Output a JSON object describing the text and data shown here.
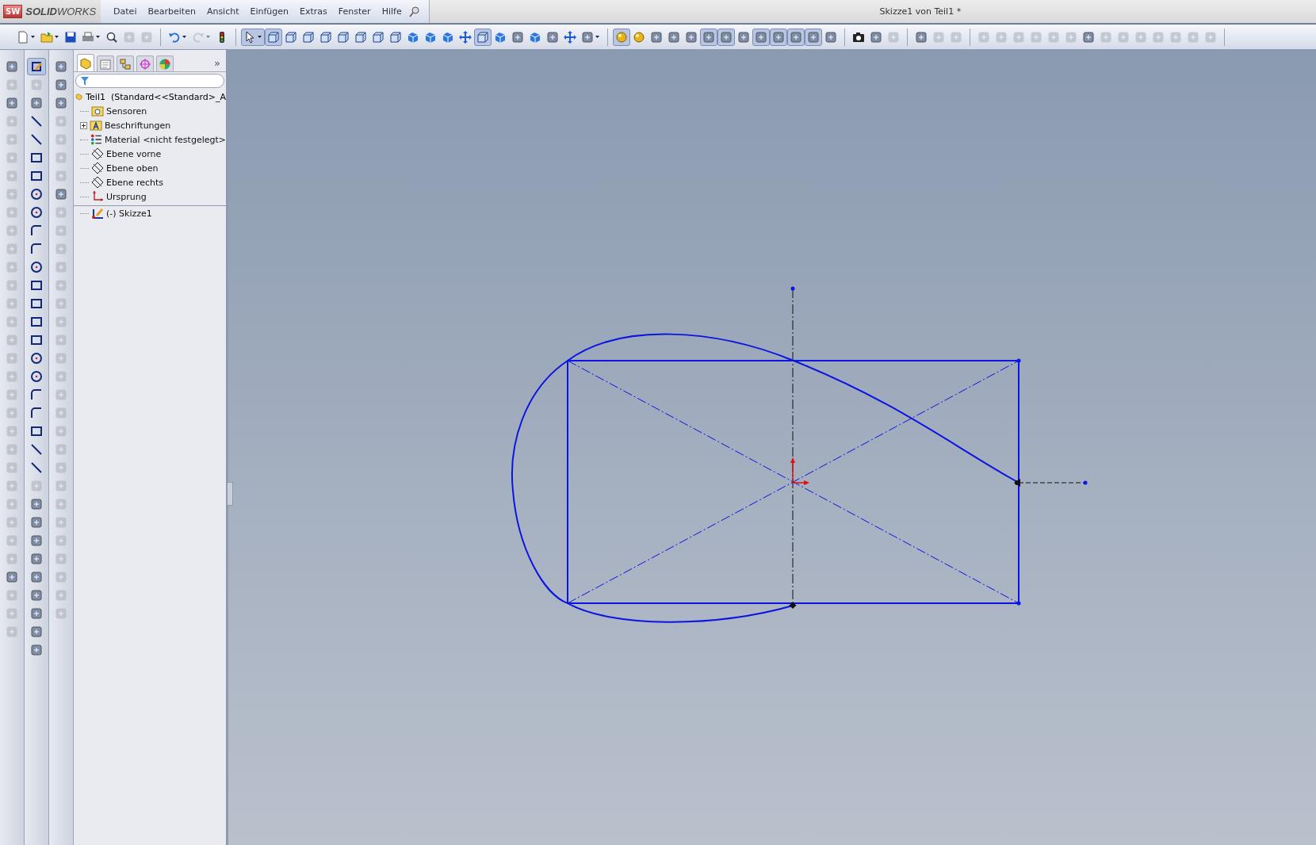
{
  "app": {
    "logo_badge": "SW",
    "logo_bold": "SOLID",
    "logo_rest": "WORKS"
  },
  "menu": [
    "Datei",
    "Bearbeiten",
    "Ansicht",
    "Einfügen",
    "Extras",
    "Fenster",
    "Hilfe"
  ],
  "window": {
    "title": "Skizze1 von Teil1 *"
  },
  "toolbar": {
    "groups": [
      [
        {
          "pressed": false,
          "disabled": false,
          "dropdown": true
        },
        {
          "pressed": false,
          "disabled": false,
          "dropdown": true
        },
        {
          "pressed": false,
          "disabled": false,
          "dropdown": false
        },
        {
          "pressed": false,
          "disabled": false,
          "dropdown": true
        },
        {
          "pressed": false,
          "disabled": false,
          "dropdown": false
        },
        {
          "pressed": false,
          "disabled": true,
          "dropdown": false
        },
        {
          "pressed": false,
          "disabled": true,
          "dropdown": false
        }
      ],
      [
        {
          "pressed": false,
          "disabled": false,
          "dropdown": true
        },
        {
          "pressed": false,
          "disabled": true,
          "dropdown": true
        },
        {
          "pressed": false,
          "disabled": false,
          "dropdown": false
        }
      ],
      [
        {
          "pressed": true,
          "disabled": false,
          "dropdown": true
        },
        {
          "pressed": true,
          "disabled": false,
          "dropdown": false
        },
        {
          "pressed": false,
          "disabled": false,
          "dropdown": false
        },
        {
          "pressed": false,
          "disabled": false,
          "dropdown": false
        },
        {
          "pressed": false,
          "disabled": false,
          "dropdown": false
        },
        {
          "pressed": false,
          "disabled": false,
          "dropdown": false
        },
        {
          "pressed": false,
          "disabled": false,
          "dropdown": false
        },
        {
          "pressed": false,
          "disabled": false,
          "dropdown": false
        },
        {
          "pressed": false,
          "disabled": false,
          "dropdown": false
        },
        {
          "pressed": false,
          "disabled": false,
          "dropdown": false
        },
        {
          "pressed": false,
          "disabled": false,
          "dropdown": false
        },
        {
          "pressed": false,
          "disabled": false,
          "dropdown": false
        },
        {
          "pressed": false,
          "disabled": false,
          "dropdown": false
        },
        {
          "pressed": true,
          "disabled": false,
          "dropdown": false
        },
        {
          "pressed": false,
          "disabled": false,
          "dropdown": false
        },
        {
          "pressed": false,
          "disabled": false,
          "dropdown": false
        },
        {
          "pressed": false,
          "disabled": false,
          "dropdown": false
        },
        {
          "pressed": false,
          "disabled": false,
          "dropdown": false
        },
        {
          "pressed": false,
          "disabled": false,
          "dropdown": false
        },
        {
          "pressed": false,
          "disabled": false,
          "dropdown": true
        }
      ],
      [
        {
          "pressed": true,
          "disabled": false,
          "dropdown": false
        },
        {
          "pressed": false,
          "disabled": false,
          "dropdown": false
        },
        {
          "pressed": false,
          "disabled": false,
          "dropdown": false
        },
        {
          "pressed": false,
          "disabled": false,
          "dropdown": false
        },
        {
          "pressed": false,
          "disabled": false,
          "dropdown": false
        },
        {
          "pressed": true,
          "disabled": false,
          "dropdown": false
        },
        {
          "pressed": true,
          "disabled": false,
          "dropdown": false
        },
        {
          "pressed": false,
          "disabled": false,
          "dropdown": false
        },
        {
          "pressed": true,
          "disabled": false,
          "dropdown": false
        },
        {
          "pressed": true,
          "disabled": false,
          "dropdown": false
        },
        {
          "pressed": true,
          "disabled": false,
          "dropdown": false
        },
        {
          "pressed": true,
          "disabled": false,
          "dropdown": false
        },
        {
          "pressed": false,
          "disabled": false,
          "dropdown": false
        }
      ],
      [
        {
          "pressed": false,
          "disabled": false,
          "dropdown": false
        },
        {
          "pressed": false,
          "disabled": false,
          "dropdown": false
        },
        {
          "pressed": false,
          "disabled": true,
          "dropdown": false
        }
      ],
      [
        {
          "pressed": false,
          "disabled": false,
          "dropdown": false
        },
        {
          "pressed": false,
          "disabled": true,
          "dropdown": false
        },
        {
          "pressed": false,
          "disabled": true,
          "dropdown": false
        }
      ],
      [
        {
          "pressed": false,
          "disabled": true,
          "dropdown": false
        },
        {
          "pressed": false,
          "disabled": true,
          "dropdown": false
        },
        {
          "pressed": false,
          "disabled": true,
          "dropdown": false
        },
        {
          "pressed": false,
          "disabled": true,
          "dropdown": false
        },
        {
          "pressed": false,
          "disabled": true,
          "dropdown": false
        },
        {
          "pressed": false,
          "disabled": true,
          "dropdown": false
        },
        {
          "pressed": false,
          "disabled": false,
          "dropdown": false
        },
        {
          "pressed": false,
          "disabled": true,
          "dropdown": false
        },
        {
          "pressed": false,
          "disabled": true,
          "dropdown": false
        },
        {
          "pressed": false,
          "disabled": true,
          "dropdown": false
        },
        {
          "pressed": false,
          "disabled": true,
          "dropdown": false
        },
        {
          "pressed": false,
          "disabled": true,
          "dropdown": false
        },
        {
          "pressed": false,
          "disabled": true,
          "dropdown": false
        },
        {
          "pressed": false,
          "disabled": true,
          "dropdown": false
        }
      ]
    ]
  },
  "side_toolbars": [
    {
      "kind": "features",
      "buttons": [
        {
          "pressed": false,
          "disabled": false
        },
        {
          "pressed": false,
          "disabled": true
        },
        {
          "pressed": false,
          "disabled": false
        },
        {
          "pressed": false,
          "disabled": true
        },
        {
          "pressed": false,
          "disabled": true
        },
        {
          "pressed": false,
          "disabled": true
        },
        {
          "pressed": false,
          "disabled": true
        },
        {
          "pressed": false,
          "disabled": true
        },
        {
          "pressed": false,
          "disabled": true
        },
        {
          "pressed": false,
          "disabled": true
        },
        {
          "pressed": false,
          "disabled": true
        },
        {
          "pressed": false,
          "disabled": true
        },
        {
          "pressed": false,
          "disabled": true
        },
        {
          "pressed": false,
          "disabled": true
        },
        {
          "pressed": false,
          "disabled": true
        },
        {
          "pressed": false,
          "disabled": true
        },
        {
          "pressed": false,
          "disabled": true
        },
        {
          "pressed": false,
          "disabled": true
        },
        {
          "pressed": false,
          "disabled": true
        },
        {
          "pressed": false,
          "disabled": true
        },
        {
          "pressed": false,
          "disabled": true
        },
        {
          "pressed": false,
          "disabled": true
        },
        {
          "pressed": false,
          "disabled": true
        },
        {
          "pressed": false,
          "disabled": true
        },
        {
          "pressed": false,
          "disabled": true
        },
        {
          "pressed": false,
          "disabled": true
        },
        {
          "pressed": false,
          "disabled": true
        },
        {
          "pressed": false,
          "disabled": true
        },
        {
          "pressed": false,
          "disabled": false
        },
        {
          "pressed": false,
          "disabled": true
        },
        {
          "pressed": false,
          "disabled": true
        },
        {
          "pressed": false,
          "disabled": true
        }
      ]
    },
    {
      "kind": "sketch",
      "buttons": [
        {
          "pressed": true,
          "disabled": false
        },
        {
          "pressed": false,
          "disabled": true
        },
        {
          "pressed": false,
          "disabled": false
        },
        {
          "pressed": false,
          "disabled": false
        },
        {
          "pressed": false,
          "disabled": false
        },
        {
          "pressed": false,
          "disabled": false
        },
        {
          "pressed": false,
          "disabled": false
        },
        {
          "pressed": false,
          "disabled": false
        },
        {
          "pressed": false,
          "disabled": false
        },
        {
          "pressed": false,
          "disabled": false
        },
        {
          "pressed": false,
          "disabled": false
        },
        {
          "pressed": false,
          "disabled": false
        },
        {
          "pressed": false,
          "disabled": false
        },
        {
          "pressed": false,
          "disabled": false
        },
        {
          "pressed": false,
          "disabled": false
        },
        {
          "pressed": false,
          "disabled": false
        },
        {
          "pressed": false,
          "disabled": false
        },
        {
          "pressed": false,
          "disabled": false
        },
        {
          "pressed": false,
          "disabled": false
        },
        {
          "pressed": false,
          "disabled": false
        },
        {
          "pressed": false,
          "disabled": false
        },
        {
          "pressed": false,
          "disabled": false
        },
        {
          "pressed": false,
          "disabled": false
        },
        {
          "pressed": false,
          "disabled": true
        },
        {
          "pressed": false,
          "disabled": false
        },
        {
          "pressed": false,
          "disabled": false
        },
        {
          "pressed": false,
          "disabled": false
        },
        {
          "pressed": false,
          "disabled": false
        },
        {
          "pressed": false,
          "disabled": false
        },
        {
          "pressed": false,
          "disabled": false
        },
        {
          "pressed": false,
          "disabled": false
        },
        {
          "pressed": false,
          "disabled": false
        },
        {
          "pressed": false,
          "disabled": false
        }
      ]
    },
    {
      "kind": "tools",
      "buttons": [
        {
          "pressed": false,
          "disabled": false
        },
        {
          "pressed": false,
          "disabled": false
        },
        {
          "pressed": false,
          "disabled": false
        },
        {
          "pressed": false,
          "disabled": true
        },
        {
          "pressed": false,
          "disabled": true
        },
        {
          "pressed": false,
          "disabled": true
        },
        {
          "pressed": false,
          "disabled": true
        },
        {
          "pressed": false,
          "disabled": false
        },
        {
          "pressed": false,
          "disabled": true
        },
        {
          "pressed": false,
          "disabled": true
        },
        {
          "pressed": false,
          "disabled": true
        },
        {
          "pressed": false,
          "disabled": true
        },
        {
          "pressed": false,
          "disabled": true
        },
        {
          "pressed": false,
          "disabled": true
        },
        {
          "pressed": false,
          "disabled": true
        },
        {
          "pressed": false,
          "disabled": true
        },
        {
          "pressed": false,
          "disabled": true
        },
        {
          "pressed": false,
          "disabled": true
        },
        {
          "pressed": false,
          "disabled": true
        },
        {
          "pressed": false,
          "disabled": true
        },
        {
          "pressed": false,
          "disabled": true
        },
        {
          "pressed": false,
          "disabled": true
        },
        {
          "pressed": false,
          "disabled": true
        },
        {
          "pressed": false,
          "disabled": true
        },
        {
          "pressed": false,
          "disabled": true
        },
        {
          "pressed": false,
          "disabled": true
        },
        {
          "pressed": false,
          "disabled": true
        },
        {
          "pressed": false,
          "disabled": true
        },
        {
          "pressed": false,
          "disabled": true
        },
        {
          "pressed": false,
          "disabled": true
        },
        {
          "pressed": false,
          "disabled": true
        }
      ]
    }
  ],
  "feature_manager": {
    "tabs": [
      {
        "selected": true
      },
      {
        "selected": false
      },
      {
        "selected": false
      },
      {
        "selected": false
      },
      {
        "selected": false
      }
    ],
    "more": "»",
    "root": {
      "label": "Teil1  (Standard<<Standard>_A"
    },
    "items": [
      {
        "kind": "sensor",
        "label": "Sensoren"
      },
      {
        "kind": "annotation",
        "label": "Beschriftungen",
        "expanded": false
      },
      {
        "kind": "material",
        "label": "Material <nicht festgelegt>"
      },
      {
        "kind": "plane",
        "label": "Ebene vorne"
      },
      {
        "kind": "plane",
        "label": "Ebene oben"
      },
      {
        "kind": "plane",
        "label": "Ebene rechts"
      },
      {
        "kind": "origin",
        "label": "Ursprung"
      },
      {
        "kind": "sketch",
        "label": "(-) Skizze1"
      }
    ]
  }
}
